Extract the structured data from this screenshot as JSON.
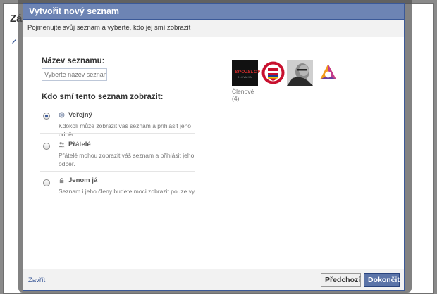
{
  "background_page": {
    "heading": "Zá"
  },
  "dialog": {
    "title": "Vytvořit nový seznam",
    "subtitle": "Pojmenujte svůj seznam a vyberte, kdo jej smí zobrazit",
    "list_name": {
      "label": "Název seznamu:",
      "placeholder": "Vyberte název seznamu."
    },
    "visibility": {
      "label": "Kdo smí tento seznam zobrazit:",
      "options": [
        {
          "title": "Veřejný",
          "description": "Kdokoli může zobrazit váš seznam a přihlásit jeho odběr.",
          "icon": "globe-icon",
          "selected": true
        },
        {
          "title": "Přátelé",
          "description": "Přátelé mohou zobrazit váš seznam a přihlásit jeho odběr.",
          "icon": "friends-icon",
          "selected": false
        },
        {
          "title": "Jenom já",
          "description": "Seznam i jeho členy budete moci zobrazit pouze vy",
          "icon": "lock-icon",
          "selected": false
        }
      ]
    },
    "members": {
      "label": "Členové (4)",
      "avatar_1_text": "SPOJSLOVAN",
      "avatar_1_sub": "SLOVAKIA"
    },
    "footer": {
      "close_label": "Zavřít",
      "previous_label": "Předchozí",
      "done_label": "Dokončit"
    }
  },
  "colors": {
    "title_bar": "#6d84b4",
    "border": "#3b5998",
    "link": "#3b5998",
    "primary_button": "#5b74a8"
  }
}
